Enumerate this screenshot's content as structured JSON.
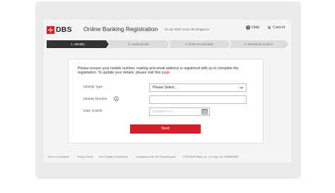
{
  "brand": {
    "logo_text": "DBS",
    "accent_color": "#d21f2b"
  },
  "header": {
    "title": "Online Banking Registration",
    "timestamp": "20 Apr 2020 11:46 AM Singapore",
    "help_label": "Help",
    "cancel_label": "Cancel"
  },
  "steps": [
    {
      "label": "1. Identify",
      "active": true
    },
    {
      "label": "2. Authenticate",
      "active": false
    },
    {
      "label": "3. Enter Credentials",
      "active": false
    },
    {
      "label": "4. Review & Confirm",
      "active": false
    }
  ],
  "form": {
    "notice_text": "Please ensure your mobile number, mailing and email address is registered with us to complete the registration. To update your details, please visit this ",
    "notice_link": "page",
    "notice_end": ".",
    "identity_type_label": "Identity Type",
    "identity_type_value": "Please Select...",
    "identity_number_label": "Identity Number",
    "identity_number_value": "",
    "dob_label": "Date of Birth",
    "dob_placeholder": "DD/MM/YYYY",
    "next_label": "Next"
  },
  "footer": {
    "terms": "Terms & Conditions",
    "privacy": "Privacy Policy",
    "fair_dealing": "Fair Dealing Commitment",
    "tax": "Compliance with Tax Requirements",
    "copyright": "©2019 DBS Bank Ltd., Co. Reg. No. 196800306E"
  },
  "icons": {
    "help": "help-icon",
    "cancel": "close-icon",
    "info": "info-icon",
    "calendar": "calendar-icon",
    "dropdown": "chevron-down-icon"
  }
}
